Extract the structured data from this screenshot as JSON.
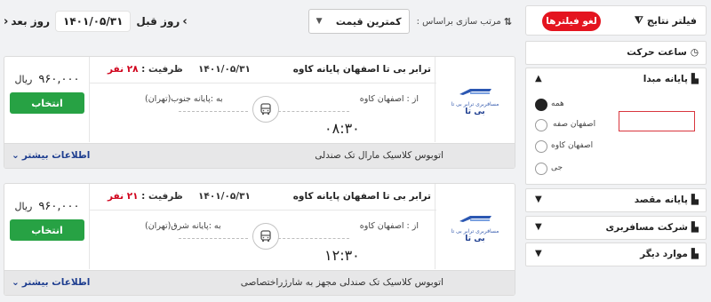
{
  "topbar": {
    "prev_day_label": "روز قبل",
    "next_day_label": "روز بعد",
    "current_date": "۱۴۰۱/۰۵/۳۱",
    "sort_label": "مرتب سازی براساس :",
    "sort_value": "کمترین قیمت"
  },
  "results": [
    {
      "route": "ترابر بی تا اصفهان پایانه کاوه",
      "date": "۱۴۰۱/۰۵/۳۱",
      "capacity_label": "ظرفیت :",
      "capacity_value": "۲۸ نفر",
      "from_label": "از : اصفهان کاوه",
      "to_label": "به :پایانه جنوب(تهران)",
      "depart_time": "۰۸:۳۰",
      "price": "۹۶۰,۰۰۰",
      "currency": "ریال",
      "select_label": "انتخاب",
      "description": "اتوبوس کلاسیک مارال تک صندلی",
      "more_info_label": "اطلاعات بیشتر",
      "logo_caption": "مسافربری ترابر بی تا",
      "logo_name": "بی تا"
    },
    {
      "route": "ترابر بی تا اصفهان پایانه کاوه",
      "date": "۱۴۰۱/۰۵/۳۱",
      "capacity_label": "ظرفیت :",
      "capacity_value": "۲۱ نفر",
      "from_label": "از : اصفهان کاوه",
      "to_label": "به :پایانه شرق(تهران)",
      "depart_time": "۱۲:۳۰",
      "price": "۹۶۰,۰۰۰",
      "currency": "ریال",
      "select_label": "انتخاب",
      "description": "اتوبوس کلاسیک تک صندلی مجهز به شارژراختصاصی",
      "more_info_label": "اطلاعات بیشتر",
      "logo_caption": "مسافربری ترابر بی تا",
      "logo_name": "بی تا"
    }
  ],
  "filters": {
    "title": "فیلتر نتایج",
    "clear_label": "لغو فیلترها",
    "sections": {
      "departure_time": "ساعت حرکت",
      "origin": "پایانه مبدا",
      "destination": "پایانه مقصد",
      "company": "شرکت مسافربری",
      "other": "موارد دیگر"
    },
    "origin_options": [
      "همه",
      "اصفهان صفه",
      "اصفهان کاوه",
      "جی"
    ]
  },
  "colors": {
    "accent_green": "#27a244",
    "accent_red": "#e4141f",
    "link_blue": "#1d3d8f",
    "capacity_red": "#d0021b"
  }
}
